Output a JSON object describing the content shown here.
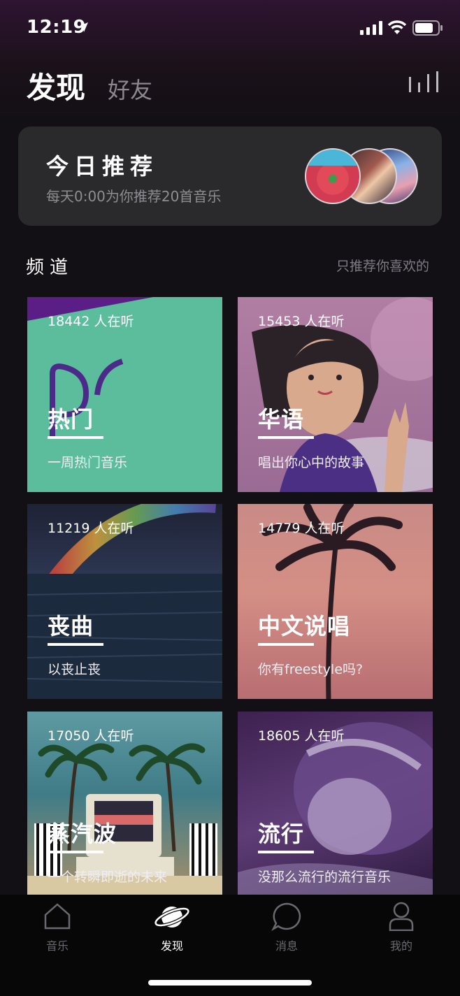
{
  "status": {
    "time": "12:19"
  },
  "header": {
    "title": "发现",
    "friends_tab": "好友"
  },
  "recommend": {
    "title": "今日推荐",
    "subtitle": "每天0:00为你推荐20首音乐"
  },
  "channels": {
    "title": "频道",
    "hint": "只推荐你喜欢的",
    "items": [
      {
        "count": "18442 人在听",
        "name": "热门",
        "desc": "一周热门音乐"
      },
      {
        "count": "15453 人在听",
        "name": "华语",
        "desc": "唱出你心中的故事"
      },
      {
        "count": "11219 人在听",
        "name": "丧曲",
        "desc": "以丧止丧"
      },
      {
        "count": "14779 人在听",
        "name": "中文说唱",
        "desc": "你有freestyle吗?"
      },
      {
        "count": "17050 人在听",
        "name": "蒸汽波",
        "desc": "一个转瞬即逝的未来"
      },
      {
        "count": "18605 人在听",
        "name": "流行",
        "desc": "没那么流行的流行音乐"
      }
    ]
  },
  "tabbar": {
    "items": [
      {
        "label": "音乐",
        "icon": "home-icon"
      },
      {
        "label": "发现",
        "icon": "planet-icon"
      },
      {
        "label": "消息",
        "icon": "chat-bubble-icon"
      },
      {
        "label": "我的",
        "icon": "user-icon"
      }
    ],
    "active_index": 1
  },
  "colors": {
    "background": "#121014",
    "card": "#2a2a2d",
    "accent_top": "#2e1431"
  }
}
